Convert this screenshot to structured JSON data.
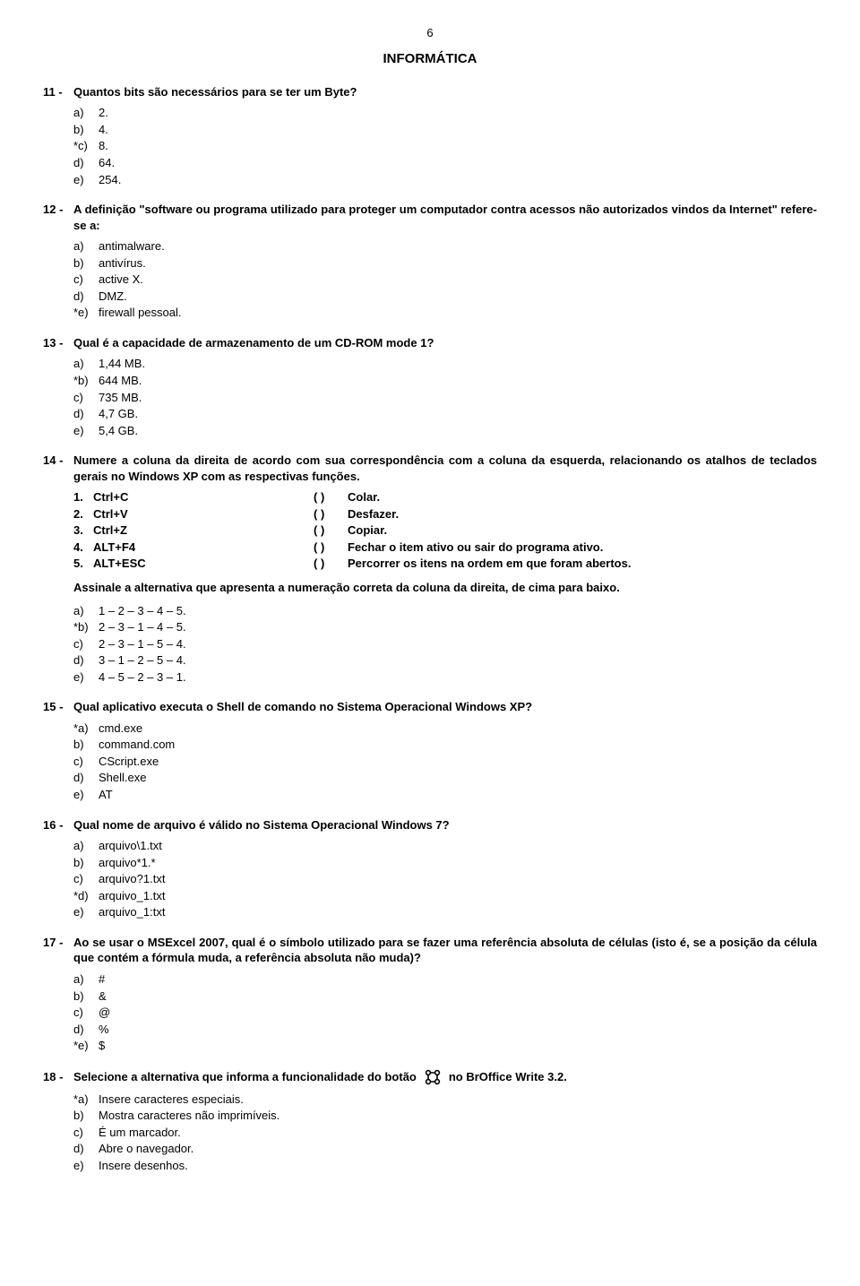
{
  "page_number": "6",
  "section_title": "INFORMÁTICA",
  "q11": {
    "num": "11 -",
    "text": "Quantos bits são necessários para se ter um Byte?",
    "opts": [
      {
        "label": "a)",
        "text": "2."
      },
      {
        "label": "b)",
        "text": "4."
      },
      {
        "label": "*c)",
        "text": "8."
      },
      {
        "label": "d)",
        "text": "64."
      },
      {
        "label": "e)",
        "text": "254."
      }
    ]
  },
  "q12": {
    "num": "12 -",
    "text": "A definição \"software ou programa utilizado para proteger um computador contra acessos não autorizados vindos da Internet\" refere-se a:",
    "opts": [
      {
        "label": "a)",
        "text": "antimalware."
      },
      {
        "label": "b)",
        "text": "antivírus."
      },
      {
        "label": "c)",
        "text": "active X."
      },
      {
        "label": "d)",
        "text": "DMZ."
      },
      {
        "label": "*e)",
        "text": "firewall pessoal."
      }
    ]
  },
  "q13": {
    "num": "13 -",
    "text": "Qual é a capacidade de armazenamento de um CD-ROM mode 1?",
    "opts": [
      {
        "label": "a)",
        "text": "1,44 MB."
      },
      {
        "label": "*b)",
        "text": "644 MB."
      },
      {
        "label": "c)",
        "text": "735 MB."
      },
      {
        "label": "d)",
        "text": "4,7 GB."
      },
      {
        "label": "e)",
        "text": "5,4 GB."
      }
    ]
  },
  "q14": {
    "num": "14 -",
    "text": "Numere a coluna da direita de acordo com sua correspondência com a coluna da esquerda, relacionando os atalhos de teclados gerais no Windows XP com as respectivas funções.",
    "pairs": [
      {
        "n": "1.",
        "left": "Ctrl+C",
        "paren": "(   )",
        "right": "Colar."
      },
      {
        "n": "2.",
        "left": "Ctrl+V",
        "paren": "(   )",
        "right": "Desfazer."
      },
      {
        "n": "3.",
        "left": "Ctrl+Z",
        "paren": "(   )",
        "right": "Copiar."
      },
      {
        "n": "4.",
        "left": "ALT+F4",
        "paren": "(   )",
        "right": "Fechar o item ativo ou sair do programa ativo."
      },
      {
        "n": "5.",
        "left": "ALT+ESC",
        "paren": "(   )",
        "right": "Percorrer os itens na ordem em que foram abertos."
      }
    ],
    "sub": "Assinale a alternativa que apresenta a numeração correta da coluna da direita, de cima para baixo.",
    "opts": [
      {
        "label": "a)",
        "text": "1 – 2 – 3 – 4 – 5."
      },
      {
        "label": "*b)",
        "text": "2 – 3 – 1 – 4 – 5."
      },
      {
        "label": "c)",
        "text": "2 – 3 – 1 – 5 – 4."
      },
      {
        "label": "d)",
        "text": "3 – 1 – 2 – 5 – 4."
      },
      {
        "label": "e)",
        "text": "4 – 5 – 2 – 3 – 1."
      }
    ]
  },
  "q15": {
    "num": "15 -",
    "text": "Qual aplicativo executa o Shell de comando no Sistema Operacional Windows XP?",
    "opts": [
      {
        "label": "*a)",
        "text": "cmd.exe"
      },
      {
        "label": "b)",
        "text": "command.com"
      },
      {
        "label": "c)",
        "text": "CScript.exe"
      },
      {
        "label": "d)",
        "text": "Shell.exe"
      },
      {
        "label": "e)",
        "text": "AT"
      }
    ]
  },
  "q16": {
    "num": "16 -",
    "text": "Qual nome de arquivo é válido no Sistema Operacional Windows 7?",
    "opts": [
      {
        "label": "a)",
        "text": "arquivo\\1.txt"
      },
      {
        "label": "b)",
        "text": "arquivo*1.*"
      },
      {
        "label": "c)",
        "text": "arquivo?1.txt"
      },
      {
        "label": "*d)",
        "text": "arquivo_1.txt"
      },
      {
        "label": "e)",
        "text": "arquivo_1:txt"
      }
    ]
  },
  "q17": {
    "num": "17 -",
    "text": "Ao se usar o MSExcel 2007, qual é o símbolo utilizado para se fazer uma referência absoluta de células (isto é, se a posição da célula que contém a fórmula muda, a referência absoluta não muda)?",
    "opts": [
      {
        "label": "a)",
        "text": "#"
      },
      {
        "label": "b)",
        "text": "&"
      },
      {
        "label": "c)",
        "text": "@"
      },
      {
        "label": "d)",
        "text": "%"
      },
      {
        "label": "*e)",
        "text": "$"
      }
    ]
  },
  "q18": {
    "num": "18 -",
    "text_before": "Selecione a alternativa que informa a funcionalidade do botão",
    "text_after": "no BrOffice Write 3.2.",
    "opts": [
      {
        "label": "*a)",
        "text": "Insere caracteres especiais."
      },
      {
        "label": "b)",
        "text": "Mostra caracteres não imprimíveis."
      },
      {
        "label": "c)",
        "text": "É um marcador."
      },
      {
        "label": "d)",
        "text": "Abre o navegador."
      },
      {
        "label": "e)",
        "text": "Insere desenhos."
      }
    ]
  }
}
